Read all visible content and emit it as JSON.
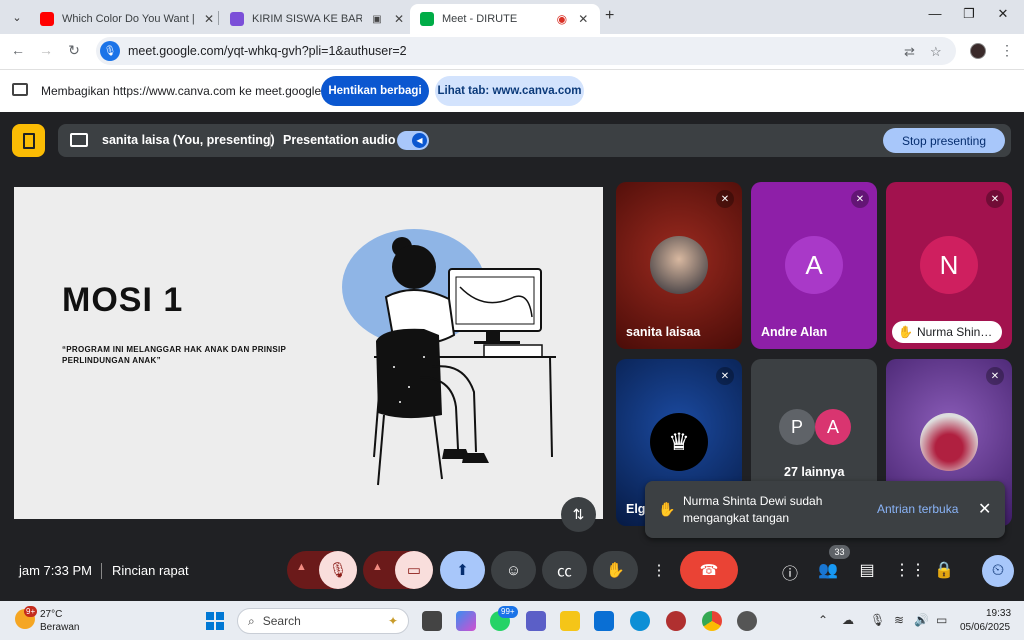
{
  "browser": {
    "tabs": [
      {
        "title": "Which Color Do You Want | Col",
        "favicon_color": "#ff0000"
      },
      {
        "title": "KIRIM SISWA KE BARAK MI",
        "favicon_color": "#7b4fd8"
      },
      {
        "title": "Meet - DIRUTE",
        "favicon_color": "#00ac47"
      }
    ],
    "url": "meet.google.com/yqt-whkq-gvh?pli=1&authuser=2"
  },
  "share_bar": {
    "text": "Membagikan https://www.canva.com ke meet.google.com",
    "stop_label": "Hentikan berbagi",
    "view_tab_label": "Lihat tab: www.canva.com"
  },
  "presenting_bar": {
    "presenter": "sanita laisa (You, presenting)",
    "audio_label": "Presentation audio",
    "stop_label": "Stop presenting"
  },
  "slide": {
    "title": "MOSI 1",
    "subtitle": "“PROGRAM INI MELANGGAR HAK ANAK DAN PRINSIP PERLINDUNGAN ANAK”"
  },
  "participants": [
    {
      "name": "sanita laisaa",
      "bg": "#7a1a14"
    },
    {
      "name": "Andre Alan",
      "initial": "A",
      "bg": "#8e1fa8",
      "avatar_color": "#a939c8"
    },
    {
      "name": "Nurma Shin…",
      "initial": "N",
      "bg": "#a2124e",
      "avatar_color": "#cf1f5f"
    },
    {
      "name": "Elg",
      "bg": "#0d2d6b"
    },
    {
      "name": "27 lainnya",
      "initials": [
        "P",
        "A"
      ],
      "bg": "#3c4043"
    },
    {
      "name": "",
      "bg": "#5a2f88"
    }
  ],
  "toast": {
    "message": "Nurma Shinta Dewi sudah mengangkat tangan",
    "action": "Antrian terbuka"
  },
  "bottom": {
    "time": "jam 7:33 PM",
    "details": "Rincian rapat",
    "people_count": "33"
  },
  "taskbar": {
    "temperature": "27°C",
    "weather": "Berawan",
    "weather_badge": "9+",
    "search_placeholder": "Search",
    "whatsapp_badge": "99+",
    "time": "19:33",
    "date": "05/06/2025"
  }
}
